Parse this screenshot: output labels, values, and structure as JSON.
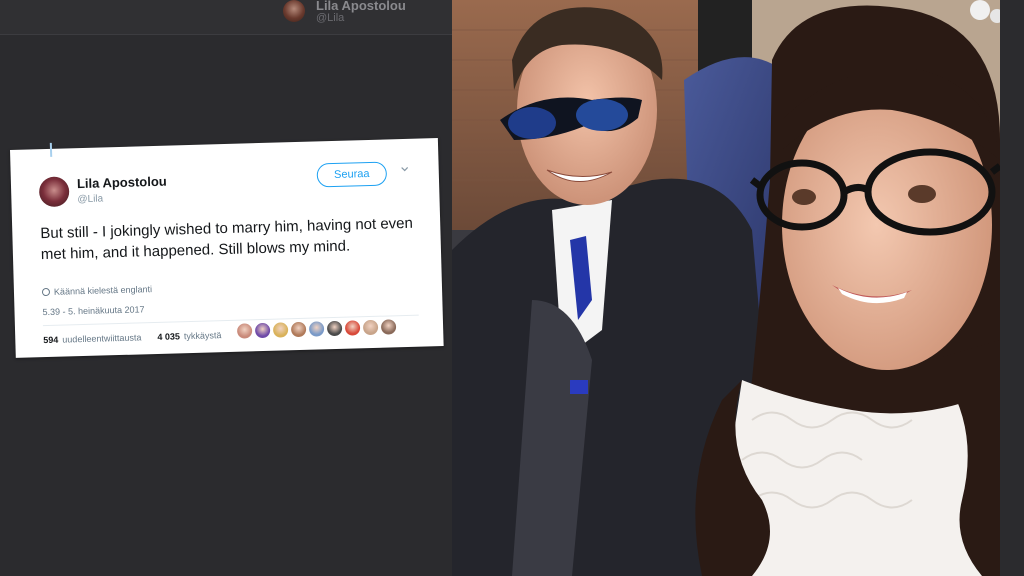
{
  "header": {
    "name": "Lila Apostolou",
    "handle": "@Lila"
  },
  "tweet": {
    "name": "Lila Apostolou",
    "handle": "@Lila",
    "follow_label": "Seuraa",
    "body": "But still - I jokingly wished to marry him, having not even met him, and it happened. Still blows my mind.",
    "translate_label": "Käännä kielestä englanti",
    "timestamp": "5.39 - 5. heinäkuuta 2017",
    "retweets_count": "594",
    "retweets_label": "uudelleentwiittausta",
    "likes_count": "4 035",
    "likes_label": "tykkäystä",
    "likers": [
      "#c98a7a",
      "#6f4aa8",
      "#d9b25a",
      "#b07a5a",
      "#7a9ac8",
      "#4a4a4a",
      "#d84a3a",
      "#c8a48a",
      "#8a6a5a"
    ]
  },
  "photo": {
    "description_icon": "selfie-photo"
  }
}
